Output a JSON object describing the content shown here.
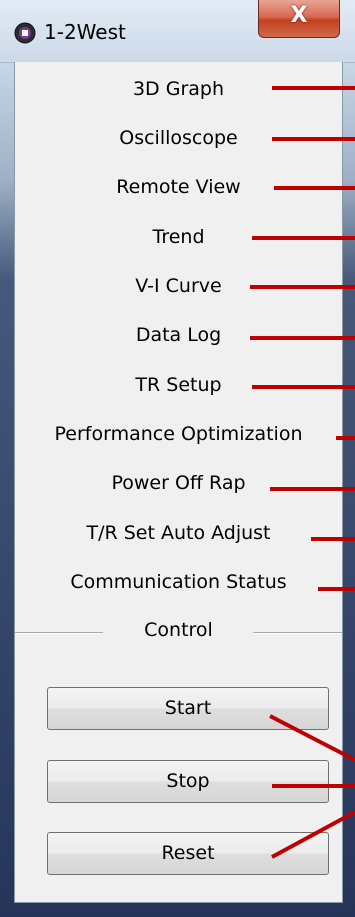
{
  "window": {
    "title": "1-2West",
    "close_glyph": "X"
  },
  "menu": {
    "items": [
      {
        "label": "3D Graph"
      },
      {
        "label": "Oscilloscope"
      },
      {
        "label": "Remote View"
      },
      {
        "label": "Trend"
      },
      {
        "label": "V-I Curve"
      },
      {
        "label": "Data Log"
      },
      {
        "label": "TR Setup"
      },
      {
        "label": "Performance Optimization"
      },
      {
        "label": "Power Off Rap"
      },
      {
        "label": "T/R Set Auto Adjust"
      },
      {
        "label": "Communication Status"
      }
    ]
  },
  "control": {
    "group_label": "Control",
    "start_label": "Start",
    "stop_label": "Stop",
    "reset_label": "Reset"
  },
  "colors": {
    "callout_line": "#c00000",
    "close_button": "#c8442a",
    "client_bg": "#f0f0f0"
  }
}
